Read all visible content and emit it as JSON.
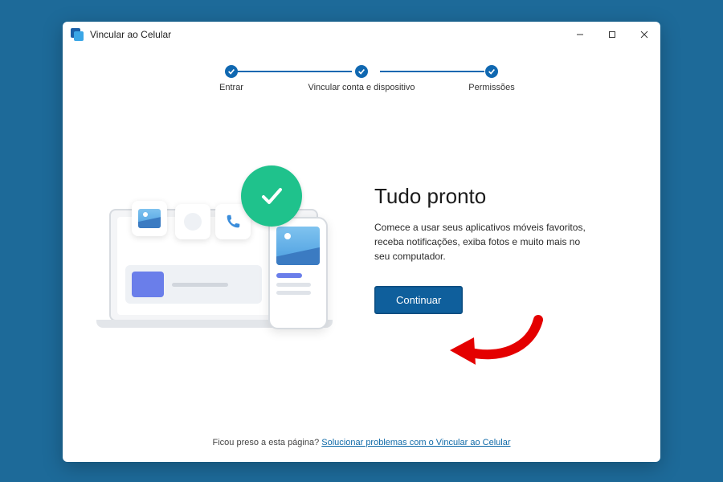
{
  "window": {
    "title": "Vincular ao Celular",
    "controls": {
      "minimize": "–",
      "maximize": "▢",
      "close": "✕"
    }
  },
  "stepper": {
    "steps": [
      {
        "label": "Entrar",
        "done": true
      },
      {
        "label": "Vincular conta e dispositivo",
        "done": true
      },
      {
        "label": "Permissões",
        "done": true
      }
    ]
  },
  "main": {
    "heading": "Tudo pronto",
    "body": "Comece a usar seus aplicativos móveis favoritos, receba notificações, exiba fotos e muito mais no seu computador.",
    "cta_label": "Continuar"
  },
  "footer": {
    "prefix": "Ficou preso a esta página? ",
    "link_text": "Solucionar problemas com o Vincular ao Celular"
  },
  "icons": {
    "photo": "photo-icon",
    "message": "message-icon",
    "phone": "phone-icon",
    "check": "check-icon"
  },
  "colors": {
    "accent": "#0f5f9c",
    "success": "#1fc28c",
    "stepper": "#1068b1"
  }
}
